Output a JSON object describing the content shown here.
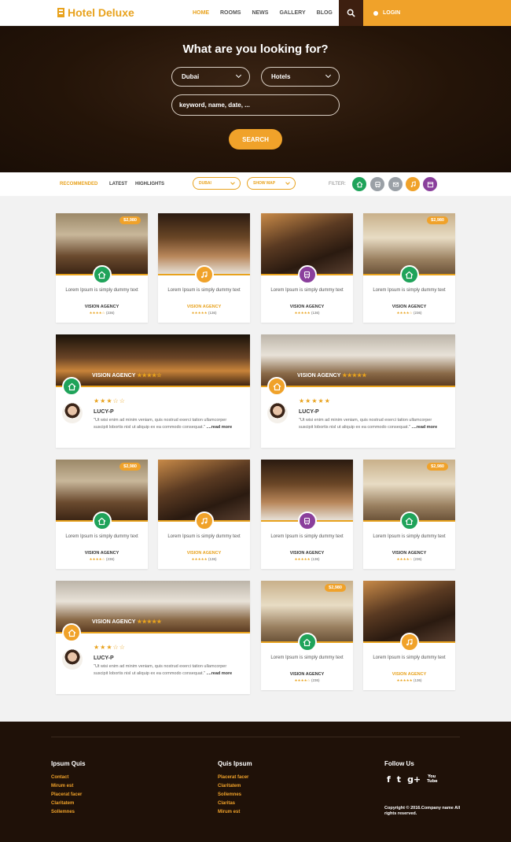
{
  "header": {
    "logo": "Hotel Deluxe",
    "nav": [
      "HOME",
      "ROOMS",
      "NEWS",
      "GALLERY",
      "BLOG"
    ],
    "login": "LOGIN"
  },
  "hero": {
    "title": "What are you looking for?",
    "city": "Dubai",
    "type": "Hotels",
    "keyword_placeholder": "keyword, name, date, ...",
    "search_label": "SEARCH"
  },
  "filterbar": {
    "tabs": [
      "RECOMMENDED",
      "LATEST",
      "HIGHLIGHTS"
    ],
    "city": "DUBAI",
    "map": "SHOW MAP",
    "filter_label": "FILTER:"
  },
  "colors": {
    "green": "#1fa35a",
    "gray": "#9aa0a6",
    "orange": "#f0a22a",
    "purple": "#8a3f9c"
  },
  "cards": [
    {
      "price": "$2,980",
      "icon": "home-icon",
      "color": "green",
      "text": "Lorem Ipsum is simply dummy text",
      "agency": "VISION AGENCY",
      "rating": "★★★★☆",
      "count": "(236)",
      "agency_orange": false
    },
    {
      "price": "",
      "icon": "music-icon",
      "color": "orange",
      "text": "Lorem Ipsum is simply dummy text",
      "agency": "VISION AGENCY",
      "rating": "★★★★★",
      "count": "(136)",
      "agency_orange": true
    },
    {
      "price": "",
      "icon": "bus-icon",
      "color": "purple",
      "text": "Lorem Ipsum is simply dummy text",
      "agency": "VISION AGENCY",
      "rating": "★★★★★",
      "count": "(136)",
      "agency_orange": false
    },
    {
      "price": "$2,980",
      "icon": "home-icon",
      "color": "green",
      "text": "Lorem Ipsum is simply dummy text",
      "agency": "VISION AGENCY",
      "rating": "★★★★☆",
      "count": "(236)",
      "agency_orange": false
    },
    {
      "price": "$2,980",
      "icon": "home-icon",
      "color": "green",
      "text": "Lorem Ipsum is simply dummy text",
      "agency": "VISION AGENCY",
      "rating": "★★★★☆",
      "count": "(236)",
      "agency_orange": false
    },
    {
      "price": "",
      "icon": "music-icon",
      "color": "orange",
      "text": "Lorem Ipsum is simply dummy text",
      "agency": "VISION AGENCY",
      "rating": "★★★★★",
      "count": "(136)",
      "agency_orange": true
    },
    {
      "price": "",
      "icon": "bus-icon",
      "color": "purple",
      "text": "Lorem Ipsum is simply dummy text",
      "agency": "VISION AGENCY",
      "rating": "★★★★★",
      "count": "(136)",
      "agency_orange": false
    },
    {
      "price": "$2,980",
      "icon": "home-icon",
      "color": "green",
      "text": "Lorem Ipsum is simply dummy text",
      "agency": "VISION AGENCY",
      "rating": "★★★★☆",
      "count": "(236)",
      "agency_orange": false
    },
    {
      "price": "$2,980",
      "icon": "home-icon",
      "color": "green",
      "text": "Lorem Ipsum is simply dummy text",
      "agency": "VISION AGENCY",
      "rating": "★★★★☆",
      "count": "(236)",
      "agency_orange": false
    },
    {
      "price": "",
      "icon": "music-icon",
      "color": "orange",
      "text": "Lorem Ipsum is simply dummy text",
      "agency": "VISION AGENCY",
      "rating": "★★★★★",
      "count": "(136)",
      "agency_orange": true
    }
  ],
  "wide": [
    {
      "label": "VISION AGENCY",
      "stars": "★★★☆☆",
      "name": "LUCY-P",
      "text": "\"Ut wisi enim ad minim veniam, quis nostrud exerci tation ullamcorper suscipit lobortis nisl ut aliquip ex ea commodo consequat.\"",
      "more": "....read more"
    },
    {
      "label": "VISION AGENCY",
      "stars": "★★★★★",
      "name": "LUCY-P",
      "text": "\"Ut wisi enim ad minim veniam, quis nostrud exerci tation ullamcorper suscipit lobortis nisl ut aliquip ex ea commodo consequat.\"",
      "more": "....read more"
    },
    {
      "label": "VISION AGENCY",
      "stars": "★★★☆☆",
      "name": "LUCY-P",
      "text": "\"Ut wisi enim ad minim veniam, quis nostrud exerci tation ullamcorper suscipit lobortis nisl ut aliquip ex ea commodo consequat.\"",
      "more": "....read more"
    }
  ],
  "footer": {
    "col1": {
      "title": "Ipsum Quis",
      "links": [
        "Contact",
        "Mirum est",
        "Placerat facer",
        "Claritatem",
        "Sollemnes"
      ]
    },
    "col2": {
      "title": "Quis Ipsum",
      "links": [
        "Placerat facer",
        "Claritatem",
        "Sollemnes",
        "Claritas",
        "Mirum est"
      ]
    },
    "follow": "Follow Us",
    "social": [
      "f",
      "t",
      "g+",
      "You Tube"
    ],
    "copyright": "Copyright © 2016.Company name All rights reserved."
  }
}
